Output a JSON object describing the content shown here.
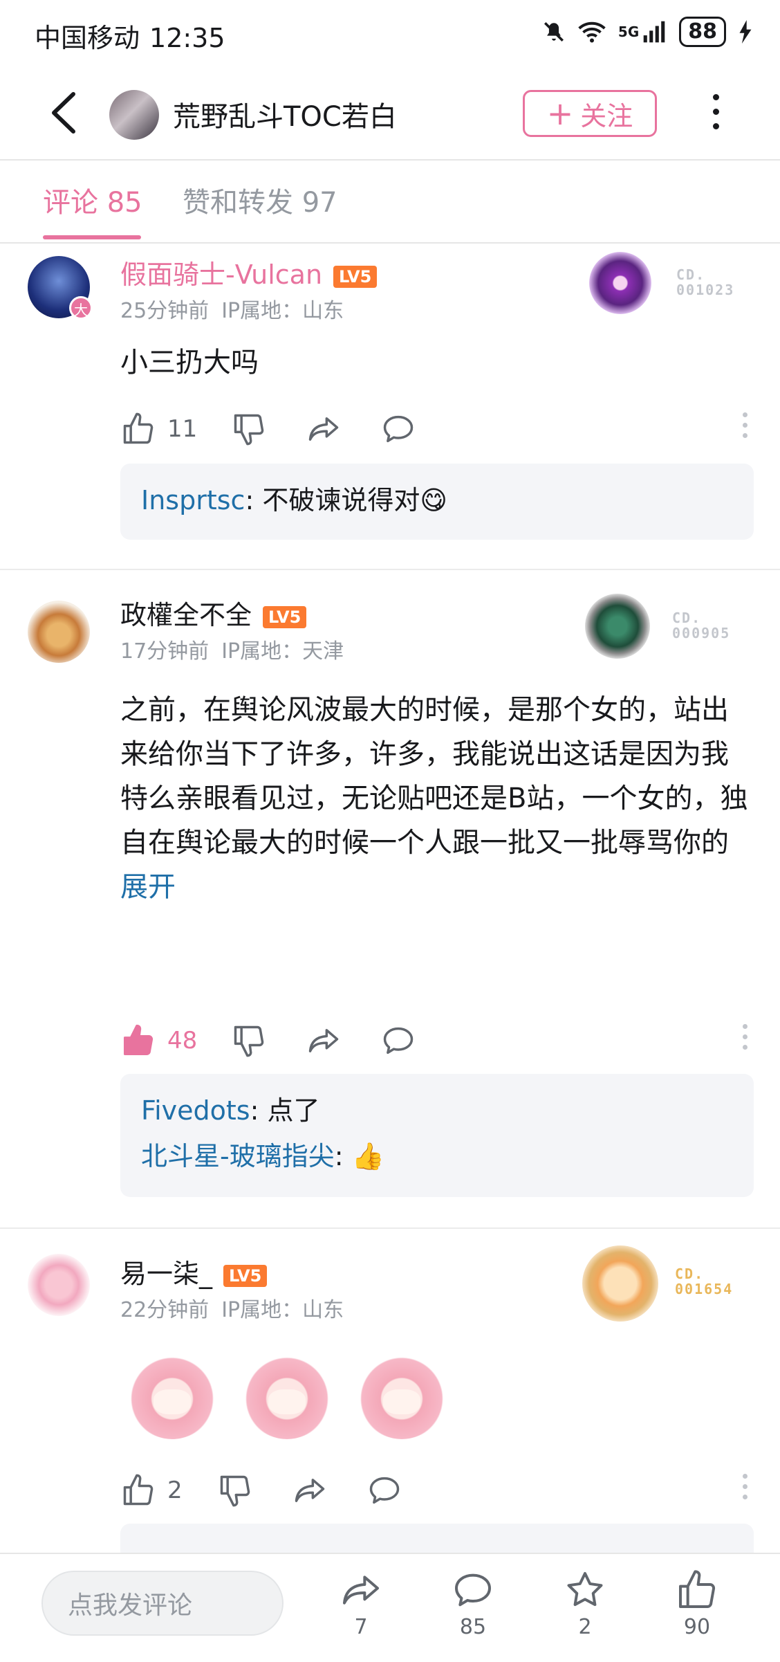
{
  "status_bar": {
    "carrier": "中国移动",
    "time": "12:35",
    "network": "5G",
    "battery": "88"
  },
  "header": {
    "title": "荒野乱斗TOC若白",
    "follow_label": "关注"
  },
  "tabs": [
    {
      "label": "评论 85"
    },
    {
      "label": "赞和转发 97"
    }
  ],
  "comments": [
    {
      "username": "假面骑士-Vulcan",
      "level": "LV5",
      "time": "25分钟前",
      "ip": "IP属地：山东",
      "badge_code": [
        "CD.",
        "001023"
      ],
      "text": "小三扔大吗",
      "likes": "11",
      "replies": [
        {
          "name": "Insprtsc",
          "text": ": 不破谏说得对😋"
        }
      ]
    },
    {
      "username": "政權全不全",
      "level": "LV5",
      "time": "17分钟前",
      "ip": "IP属地：天津",
      "badge_code": [
        "CD.",
        "000905"
      ],
      "text": "之前，在舆论风波最大的时候，是那个女的，站出来给你当下了许多，许多，我能说出这话是因为我特么亲眼看见过，无论贴吧还是B站，一个女的，独自在舆论最大的时候一个人跟一批又一批辱骂你的人辩解，对线，我当时就想，怎么会有这么爱你的女孩?这，还挑什",
      "expand": "展开",
      "likes": "48",
      "replies": [
        {
          "name": "Fivedots",
          "text": ": 点了"
        },
        {
          "name": "北斗星-玻璃指尖",
          "text": ": 👍"
        }
      ]
    },
    {
      "username": "易一柒_",
      "level": "LV5",
      "time": "22分钟前",
      "ip": "IP属地：山东",
      "badge_code": [
        "CD.",
        "001654"
      ],
      "likes": "2"
    }
  ],
  "bottom_bar": {
    "input_placeholder": "点我发评论",
    "share": "7",
    "comments": "85",
    "favorites": "2",
    "likes": "90"
  },
  "colors": {
    "accent": "#e8739e",
    "link": "#1f6fa8",
    "level": "#fb7a30"
  }
}
